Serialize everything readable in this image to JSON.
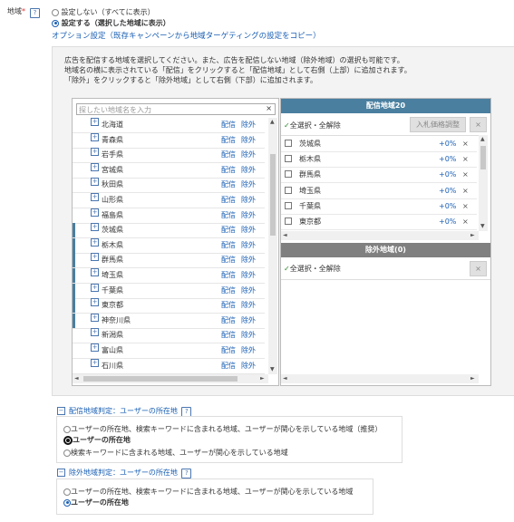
{
  "region_field": {
    "label": "地域",
    "required_mark": "*",
    "help": "?",
    "option_none": "設定しない（すべてに表示）",
    "option_set": "設定する（選択した地域に表示）",
    "option_link": "オプション設定（既存キャンペーンから地域ターゲティングの設定をコピー）"
  },
  "description": [
    "広告を配信する地域を選択してください。また、広告を配信しない地域（除外地域）の選択も可能です。",
    "地域名の横に表示されている「配信」をクリックすると「配信地域」として右側（上部）に追加されます。",
    "「除外」をクリックすると「除外地域」として右側（下部）に追加されます。"
  ],
  "search": {
    "placeholder": "探したい地域名を入力",
    "clear": "×"
  },
  "prefectures": [
    {
      "name": "北海道",
      "deliver": "配信",
      "exclude": "除外",
      "selected": false
    },
    {
      "name": "青森県",
      "deliver": "配信",
      "exclude": "除外",
      "selected": false
    },
    {
      "name": "岩手県",
      "deliver": "配信",
      "exclude": "除外",
      "selected": false
    },
    {
      "name": "宮城県",
      "deliver": "配信",
      "exclude": "除外",
      "selected": false
    },
    {
      "name": "秋田県",
      "deliver": "配信",
      "exclude": "除外",
      "selected": false
    },
    {
      "name": "山形県",
      "deliver": "配信",
      "exclude": "除外",
      "selected": false
    },
    {
      "name": "福島県",
      "deliver": "配信",
      "exclude": "除外",
      "selected": false
    },
    {
      "name": "茨城県",
      "deliver": "配信",
      "exclude": "除外",
      "selected": true
    },
    {
      "name": "栃木県",
      "deliver": "配信",
      "exclude": "除外",
      "selected": true
    },
    {
      "name": "群馬県",
      "deliver": "配信",
      "exclude": "除外",
      "selected": true
    },
    {
      "name": "埼玉県",
      "deliver": "配信",
      "exclude": "除外",
      "selected": true
    },
    {
      "name": "千葉県",
      "deliver": "配信",
      "exclude": "除外",
      "selected": true
    },
    {
      "name": "東京都",
      "deliver": "配信",
      "exclude": "除外",
      "selected": true
    },
    {
      "name": "神奈川県",
      "deliver": "配信",
      "exclude": "除外",
      "selected": true
    },
    {
      "name": "新潟県",
      "deliver": "配信",
      "exclude": "除外",
      "selected": false
    },
    {
      "name": "富山県",
      "deliver": "配信",
      "exclude": "除外",
      "selected": false
    },
    {
      "name": "石川県",
      "deliver": "配信",
      "exclude": "除外",
      "selected": false
    }
  ],
  "delivery_panel": {
    "title": "配信地域20",
    "select_all": "全選択・全解除",
    "bid_button": "入札価格調整",
    "remove_button": "×",
    "items": [
      {
        "name": "茨城県",
        "bid": "+0%",
        "remove": "×"
      },
      {
        "name": "栃木県",
        "bid": "+0%",
        "remove": "×"
      },
      {
        "name": "群馬県",
        "bid": "+0%",
        "remove": "×"
      },
      {
        "name": "埼玉県",
        "bid": "+0%",
        "remove": "×"
      },
      {
        "name": "千葉県",
        "bid": "+0%",
        "remove": "×"
      },
      {
        "name": "東京都",
        "bid": "+0%",
        "remove": "×"
      }
    ]
  },
  "exclude_panel": {
    "title": "除外地域(0)",
    "select_all": "全選択・全解除",
    "remove_button": "×"
  },
  "delivery_judgement": {
    "title": "配信地域判定：ユーザーの所在地",
    "help": "?",
    "options": [
      "ユーザーの所在地、検索キーワードに含まれる地域、ユーザーが関心を示している地域（推奨）",
      "ユーザーの所在地",
      "検索キーワードに含まれる地域、ユーザーが関心を示している地域"
    ],
    "selected_index": 1
  },
  "exclude_judgement": {
    "title": "除外地域判定：ユーザーの所在地",
    "help": "?",
    "options": [
      "ユーザーの所在地、検索キーワードに含まれる地域、ユーザーが関心を示している地域",
      "ユーザーの所在地"
    ],
    "selected_index": 1
  },
  "colors": {
    "panel_header": "#4a7fa0",
    "exclude_header": "#808080",
    "link": "#1a5fb4"
  }
}
